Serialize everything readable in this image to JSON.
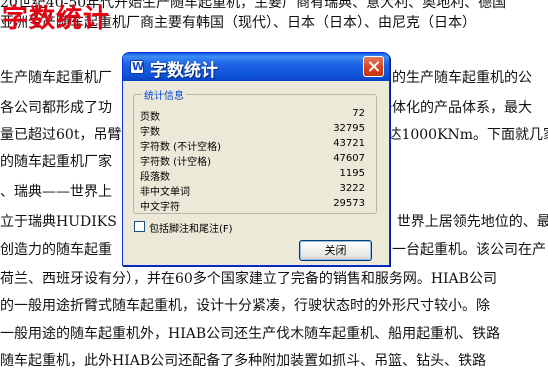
{
  "overlay_title": "字数统计",
  "document": {
    "lines": [
      "20世纪40-50年代开始生产随车起重机，主要厂商有瑞典、意大利、奥地利、德国",
      "亚洲生产随车起重机厂商主要有韩国（现代）、日本（日本）、由尼克（日本）",
      "生产随车起重机厂　　　　　　　　　　　　　　　　　　　名的生产随车起重机的公",
      "各公司都形成了功　　　　　　　　　　　　　　　　　　　一体化的产品体系，最大",
      "量已超过60t，吊臂　　　　　　　　　　　　　　　　　　　达1000KNm。下面就几家",
      "的随车起重机厂家",
      "、瑞典——世界上",
      "立于瑞典HUDIKS　　　　　　　　　　　　　　　　　　　　世界上居领先地位的、最",
      "创造力的随车起重　　　　　　　　　　　　　　　　　　　　一台起重机。该公司在产",
      "荷兰、西班牙设有分），并在60多个国家建立了完备的销售和服务网。HIAB公司",
      "的一般用途折臂式随车起重机，设计十分紧凑，行驶状态时的外形尺寸较小。除",
      "一般用途的随车起重机外，HIAB公司还生产伐木随车起重机、船用起重机、铁路",
      "随车起重机，此外HIAB公司还配备了多种附加装置如抓斗、吊篮、钻头、铁路"
    ]
  },
  "dialog": {
    "title": "字数统计",
    "app_icon_letter": "W",
    "group_label": "统计信息",
    "stats": [
      {
        "label": "页数",
        "value": "72"
      },
      {
        "label": "字数",
        "value": "32795"
      },
      {
        "label": "字符数 (不计空格)",
        "value": "43721"
      },
      {
        "label": "字符数 (计空格)",
        "value": "47607"
      },
      {
        "label": "段落数",
        "value": "1195"
      },
      {
        "label": "非中文单词",
        "value": "3222"
      },
      {
        "label": "中文字符",
        "value": "29573"
      }
    ],
    "checkbox_label": "包括脚注和尾注(F)",
    "checkbox_checked": false,
    "close_button_label": "关闭"
  }
}
